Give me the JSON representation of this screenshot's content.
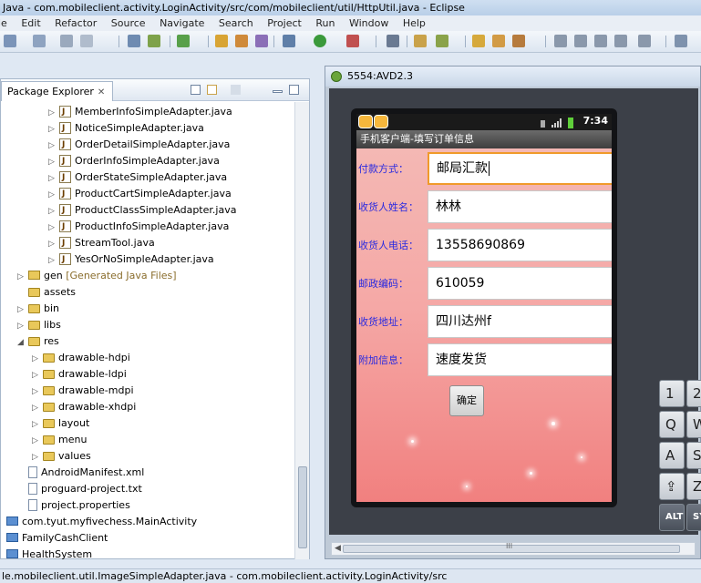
{
  "window": {
    "title": "Java - com.mobileclient.activity.LoginActivity/src/com/mobileclient/util/HttpUtil.java - Eclipse"
  },
  "menu": [
    "le",
    "Edit",
    "Refactor",
    "Source",
    "Navigate",
    "Search",
    "Project",
    "Run",
    "Window",
    "Help"
  ],
  "package_explorer": {
    "tab_label": "Package Explorer",
    "close_glyph": "✕",
    "items": [
      {
        "label": "MemberInfoSimpleAdapter.java",
        "kind": "java"
      },
      {
        "label": "NoticeSimpleAdapter.java",
        "kind": "java"
      },
      {
        "label": "OrderDetailSimpleAdapter.java",
        "kind": "java"
      },
      {
        "label": "OrderInfoSimpleAdapter.java",
        "kind": "java"
      },
      {
        "label": "OrderStateSimpleAdapter.java",
        "kind": "java"
      },
      {
        "label": "ProductCartSimpleAdapter.java",
        "kind": "java"
      },
      {
        "label": "ProductClassSimpleAdapter.java",
        "kind": "java"
      },
      {
        "label": "ProductInfoSimpleAdapter.java",
        "kind": "java"
      },
      {
        "label": "StreamTool.java",
        "kind": "java"
      },
      {
        "label": "YesOrNoSimpleAdapter.java",
        "kind": "java"
      },
      {
        "label": "gen",
        "kind": "pkgf",
        "note": "[Generated Java Files]"
      },
      {
        "label": "assets",
        "kind": "folder"
      },
      {
        "label": "bin",
        "kind": "folder"
      },
      {
        "label": "libs",
        "kind": "folder"
      },
      {
        "label": "res",
        "kind": "folder"
      },
      {
        "label": "drawable-hdpi",
        "kind": "folder"
      },
      {
        "label": "drawable-ldpi",
        "kind": "folder"
      },
      {
        "label": "drawable-mdpi",
        "kind": "folder"
      },
      {
        "label": "drawable-xhdpi",
        "kind": "folder"
      },
      {
        "label": "layout",
        "kind": "folder"
      },
      {
        "label": "menu",
        "kind": "folder"
      },
      {
        "label": "values",
        "kind": "folder"
      },
      {
        "label": "AndroidManifest.xml",
        "kind": "file"
      },
      {
        "label": "proguard-project.txt",
        "kind": "file"
      },
      {
        "label": "project.properties",
        "kind": "file"
      },
      {
        "label": "com.tyut.myfivechess.MainActivity",
        "kind": "proj"
      },
      {
        "label": "FamilyCashClient",
        "kind": "proj"
      },
      {
        "label": "HealthSystem",
        "kind": "proj"
      }
    ]
  },
  "emulator": {
    "window_title": "5554:AVD2.3",
    "status_time": "7:34",
    "app_title": "手机客户端-填写订单信息",
    "fields": [
      {
        "label": "付款方式：",
        "value": "邮局汇款"
      },
      {
        "label": "收货人姓名：",
        "value": "林林"
      },
      {
        "label": "收货人电话：",
        "value": "13558690869"
      },
      {
        "label": "邮政编码：",
        "value": "610059"
      },
      {
        "label": "收货地址：",
        "value": "四川达州f"
      },
      {
        "label": "附加信息：",
        "value": "速度发货"
      }
    ],
    "ok_button": "确定",
    "keyboard": {
      "keys": [
        "1",
        "2",
        "Q",
        "W",
        "A",
        "S",
        "⇪",
        "Z",
        "ALT",
        "SY"
      ]
    },
    "hscroll_grip": "III"
  },
  "status_bar": {
    "text": "le.mobileclient.util.ImageSimpleAdapter.java - com.mobileclient.activity.LoginActivity/src"
  }
}
